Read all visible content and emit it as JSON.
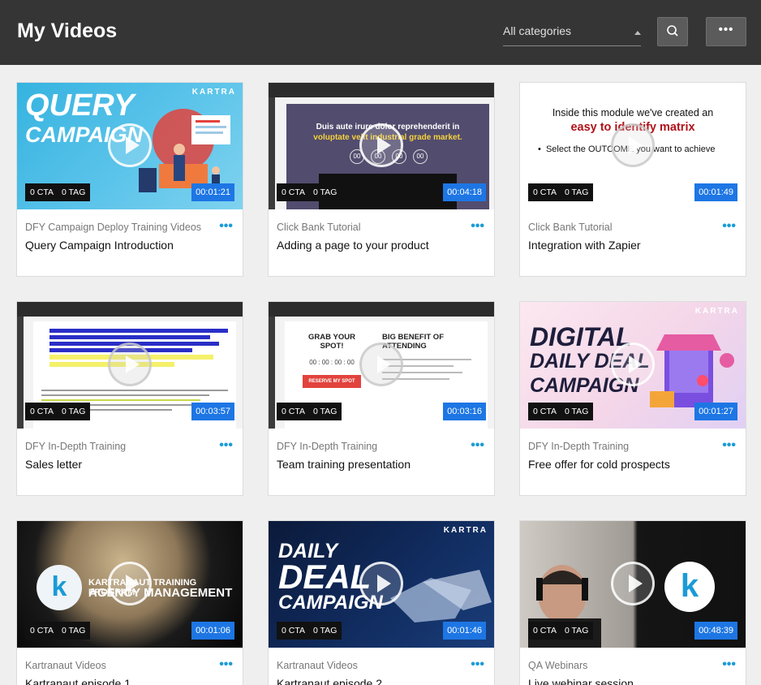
{
  "header": {
    "title": "My Videos",
    "category_select": "All categories",
    "more_label": "•••"
  },
  "cards": [
    {
      "category": "DFY Campaign Deploy Training Videos",
      "title": "Query Campaign Introduction",
      "cta": "0 CTA",
      "tag": "0 TAG",
      "duration": "00:01:21",
      "thumb_text": [
        "QUERY",
        "CAMPAIGN"
      ]
    },
    {
      "category": "Click Bank Tutorial",
      "title": "Adding a page to your product",
      "cta": "0 CTA",
      "tag": "0 TAG",
      "duration": "00:04:18",
      "thumb_text": [
        "Duis aute irure dolor reprehenderit in",
        "voluptate velit industrial grade market."
      ]
    },
    {
      "category": "Click Bank Tutorial",
      "title": "Integration with Zapier",
      "cta": "0 CTA",
      "tag": "0 TAG",
      "duration": "00:01:49",
      "thumb_text": [
        "Inside this module we've created an",
        "easy to identify matrix",
        "Select the OUTCOME you want to achieve"
      ]
    },
    {
      "category": "DFY In-Depth Training",
      "title": "Sales letter",
      "cta": "0 CTA",
      "tag": "0 TAG",
      "duration": "00:03:57"
    },
    {
      "category": "DFY In-Depth Training",
      "title": "Team training presentation",
      "cta": "0 CTA",
      "tag": "0 TAG",
      "duration": "00:03:16",
      "thumb_text": [
        "GRAB YOUR SPOT!",
        "BIG BENEFIT OF ATTENDING",
        "RESERVE MY SPOT"
      ]
    },
    {
      "category": "DFY In-Depth Training",
      "title": "Free offer for cold prospects",
      "cta": "0 CTA",
      "tag": "0 TAG",
      "duration": "00:01:27",
      "thumb_text": [
        "DIGITAL",
        "DAILY DEAL",
        "CAMPAIGN"
      ]
    },
    {
      "category": "Kartranaut Videos",
      "title": "Kartranaut episode 1",
      "cta": "0 CTA",
      "tag": "0 TAG",
      "duration": "00:01:06",
      "thumb_text": [
        "KARTRANAUT TRAINING PROGRAM",
        "AGENCY MANAGEMENT"
      ]
    },
    {
      "category": "Kartranaut Videos",
      "title": "Kartranaut episode 2",
      "cta": "0 CTA",
      "tag": "0 TAG",
      "duration": "00:01:46",
      "thumb_text": [
        "DAILY",
        "DEAL",
        "CAMPAIGN"
      ]
    },
    {
      "category": "QA Webinars",
      "title": "Live webinar session",
      "cta": "0 CTA",
      "tag": "0 TAG",
      "duration": "00:48:39"
    }
  ],
  "brand": {
    "logo_text": "KARTRA",
    "accent": "#1a9bd6",
    "duration_badge": "#1d76e4"
  }
}
